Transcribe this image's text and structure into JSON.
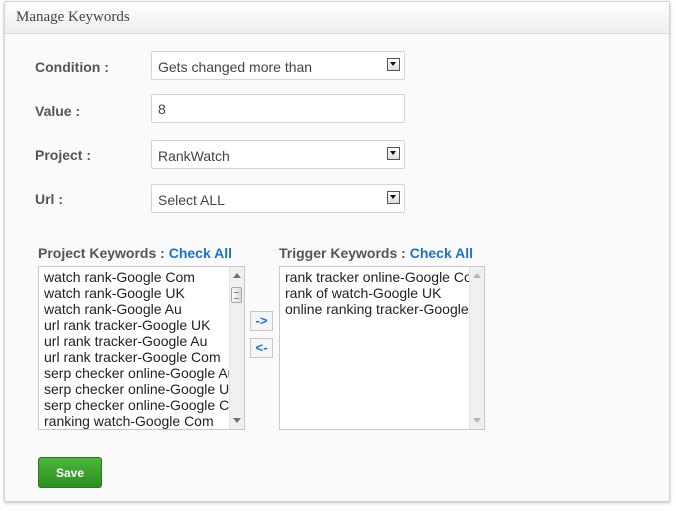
{
  "panel": {
    "title": "Manage Keywords"
  },
  "form": {
    "condition": {
      "label": "Condition :",
      "value": "Gets changed more than"
    },
    "value": {
      "label": "Value :",
      "value": "8"
    },
    "project": {
      "label": "Project :",
      "value": "RankWatch"
    },
    "url": {
      "label": "Url :",
      "value": "Select ALL"
    }
  },
  "project_keywords": {
    "heading": "Project Keywords :",
    "check_all": "Check All",
    "items": [
      "watch rank-Google Com",
      "watch rank-Google UK",
      "watch rank-Google Au",
      "url rank tracker-Google UK",
      "url rank tracker-Google Au",
      "url rank tracker-Google Com",
      "serp checker online-Google Au",
      "serp checker online-Google UK",
      "serp checker online-Google Com",
      "ranking watch-Google Com"
    ]
  },
  "trigger_keywords": {
    "heading": "Trigger Keywords :",
    "check_all": "Check All",
    "items": [
      "rank tracker online-Google Com",
      "rank of watch-Google UK",
      "online ranking tracker-Google Com"
    ]
  },
  "move_buttons": {
    "add": "->",
    "remove": "<-"
  },
  "save_label": "Save",
  "colors": {
    "link": "#1a73c9",
    "save_button": "#35a228"
  }
}
